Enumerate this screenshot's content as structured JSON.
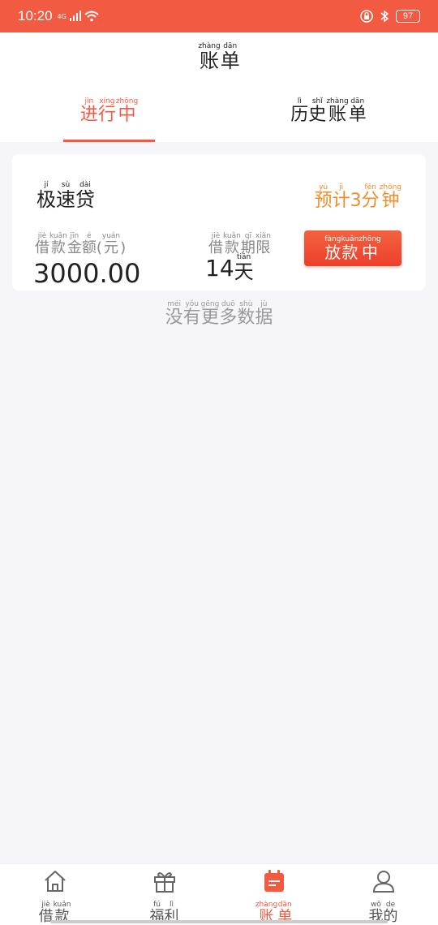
{
  "status_bar": {
    "time": "10:20",
    "network": "4G",
    "battery": "97"
  },
  "header": {
    "title": {
      "chars": [
        "账",
        "单"
      ],
      "pinyin": [
        "zhàng",
        "dān"
      ]
    },
    "tabs": [
      {
        "chars": [
          "进",
          "行",
          "中"
        ],
        "pinyin": [
          "jìn",
          "xíng",
          "zhōng"
        ],
        "active": true
      },
      {
        "chars": [
          "历",
          "史",
          "账",
          "单"
        ],
        "pinyin": [
          "lì",
          "shǐ",
          "zhàng",
          "dān"
        ],
        "active": false
      }
    ]
  },
  "loan_card": {
    "product_name": {
      "chars": [
        "极",
        "速",
        "贷"
      ],
      "pinyin": [
        "jí",
        "sù",
        "dài"
      ]
    },
    "estimate": {
      "chars": [
        "预",
        "计",
        "3",
        "分",
        "钟"
      ],
      "pinyin": [
        "yù",
        "jì",
        "",
        "fēn",
        "zhōng"
      ]
    },
    "amount_label": {
      "chars": [
        "借",
        "款",
        "金",
        "额",
        "(",
        "元",
        ")"
      ],
      "pinyin": [
        "jiè",
        "kuǎn",
        "jīn",
        "é",
        "",
        "yuán",
        ""
      ]
    },
    "amount_value": "3000.00",
    "term_label": {
      "chars": [
        "借",
        "款",
        "期",
        "限"
      ],
      "pinyin": [
        "jiè",
        "kuǎn",
        "qī",
        "xiàn"
      ]
    },
    "term_number": "14",
    "term_unit": {
      "chars": [
        "天"
      ],
      "pinyin": [
        "tiān"
      ]
    },
    "status_button": {
      "chars": [
        "放",
        "款",
        "中"
      ],
      "pinyin": [
        "fàng",
        "kuǎn",
        "zhōng"
      ]
    }
  },
  "no_more": {
    "chars": [
      "没",
      "有",
      "更",
      "多",
      "数",
      "据"
    ],
    "pinyin": [
      "méi",
      "yǒu",
      "gēng",
      "duō",
      "shù",
      "jù"
    ]
  },
  "bottom_nav": [
    {
      "icon": "home-icon",
      "chars": [
        "借",
        "款"
      ],
      "pinyin": [
        "jiè",
        "kuǎn"
      ],
      "active": false
    },
    {
      "icon": "gift-icon",
      "chars": [
        "福",
        "利"
      ],
      "pinyin": [
        "fú",
        "lì"
      ],
      "active": false
    },
    {
      "icon": "bill-icon",
      "chars": [
        "账",
        "单"
      ],
      "pinyin": [
        "zhàng",
        "dān"
      ],
      "active": true
    },
    {
      "icon": "user-icon",
      "chars": [
        "我",
        "的"
      ],
      "pinyin": [
        "wǒ",
        "de"
      ],
      "active": false
    }
  ],
  "colors": {
    "accent": "#f25a42",
    "orange": "#f08c2a",
    "muted": "#888888",
    "background": "#f6f6fa"
  }
}
